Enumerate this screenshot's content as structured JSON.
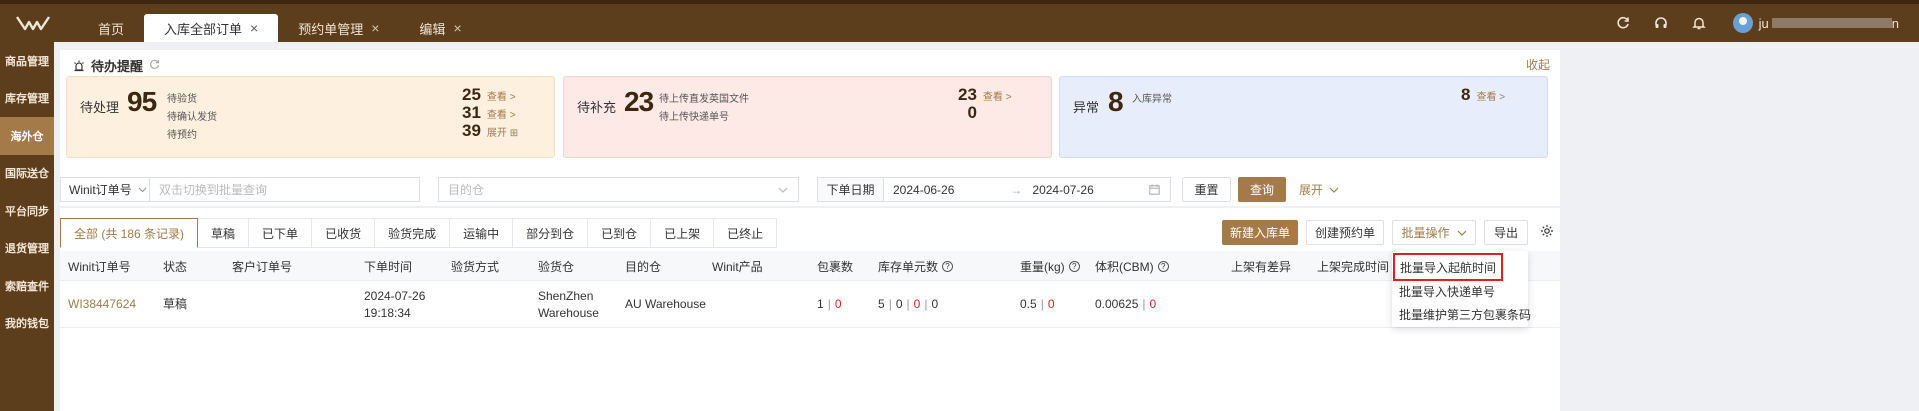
{
  "topbar": {
    "logo_icon": "winit-logo-icon",
    "tabs": [
      {
        "label": "首页",
        "closable": false,
        "active": false
      },
      {
        "label": "入库全部订单",
        "closable": true,
        "active": true
      },
      {
        "label": "预约单管理",
        "closable": true,
        "active": false
      },
      {
        "label": "编辑",
        "closable": true,
        "active": false
      }
    ],
    "close_glyph": "×",
    "icons": [
      "refresh-icon",
      "headset-icon",
      "bell-icon"
    ],
    "user_prefix": "ju",
    "user_suffix": "n"
  },
  "sidebar": {
    "items": [
      {
        "label": "商品管理",
        "active": false
      },
      {
        "label": "库存管理",
        "active": false
      },
      {
        "label": "海外仓",
        "active": true
      },
      {
        "label": "国际送仓",
        "active": false
      },
      {
        "label": "平台同步",
        "active": false
      },
      {
        "label": "退货管理",
        "active": false
      },
      {
        "label": "索赔查件",
        "active": false
      },
      {
        "label": "我的钱包",
        "active": false
      }
    ]
  },
  "todo": {
    "title": "待办提醒",
    "collapse": "收起",
    "cards": [
      {
        "label": "待处理",
        "total": "95",
        "items": [
          "待验货",
          "待确认发货",
          "待预约"
        ],
        "values": [
          {
            "num": "25",
            "link": "查看 >"
          },
          {
            "num": "31",
            "link": "查看 >"
          },
          {
            "num": "39",
            "link": "展开 ⊞"
          }
        ]
      },
      {
        "label": "待补充",
        "total": "23",
        "items": [
          "待上传直发英国文件",
          "待上传快递单号"
        ],
        "values": [
          {
            "num": "23",
            "link": "查看 >"
          },
          {
            "num": "0",
            "link": ""
          }
        ]
      },
      {
        "label": "异常",
        "total": "8",
        "items": [
          "入库异常"
        ],
        "values": [
          {
            "num": "8",
            "link": "查看 >"
          }
        ]
      }
    ]
  },
  "filters": {
    "order_type": "Winit订单号",
    "order_input_placeholder": "双击切换到批量查询",
    "warehouse_placeholder": "目的仓",
    "date_label": "下单日期",
    "date_from": "2024-06-26",
    "date_to": "2024-07-26",
    "reset": "重置",
    "search": "查询",
    "expand": "展开"
  },
  "list": {
    "status_tabs": [
      "全部 (共 186 条记录)",
      "草稿",
      "已下单",
      "已收货",
      "验货完成",
      "运输中",
      "部分到仓",
      "已到仓",
      "已上架",
      "已终止"
    ],
    "actions": {
      "new": "新建入库单",
      "create_appt": "创建预约单",
      "batch": "批量操作",
      "export": "导出"
    },
    "columns": [
      "Winit订单号",
      "状态",
      "客户订单号",
      "下单时间",
      "验货方式",
      "验货仓",
      "目的仓",
      "Winit产品",
      "包裹数",
      "库存单元数",
      "重量(kg)",
      "体积(CBM)",
      "上架有差异",
      "上架完成时间"
    ],
    "rows": [
      {
        "order_no": "WI38447624",
        "status": "草稿",
        "customer_no": "",
        "date": "2024-07-26",
        "time": "19:18:34",
        "inspect_method": "",
        "inspect_wh_1": "ShenZhen",
        "inspect_wh_2": "Warehouse",
        "dest_wh": "AU Warehouse",
        "product": "",
        "pkg_a": "1",
        "pkg_b": "0",
        "sku_a": "5",
        "sku_b": "0",
        "sku_c": "0",
        "sku_d": "0",
        "weight_a": "0.5",
        "weight_b": "0",
        "vol_a": "0.00625",
        "vol_b": "0"
      }
    ]
  },
  "batch_menu": [
    "批量导入起航时间",
    "批量导入快递单号",
    "批量维护第三方包裹条码"
  ],
  "colors": {
    "brand_dark": "#5c3d1c",
    "brand": "#a37a48",
    "highlight_red": "#e02020"
  }
}
